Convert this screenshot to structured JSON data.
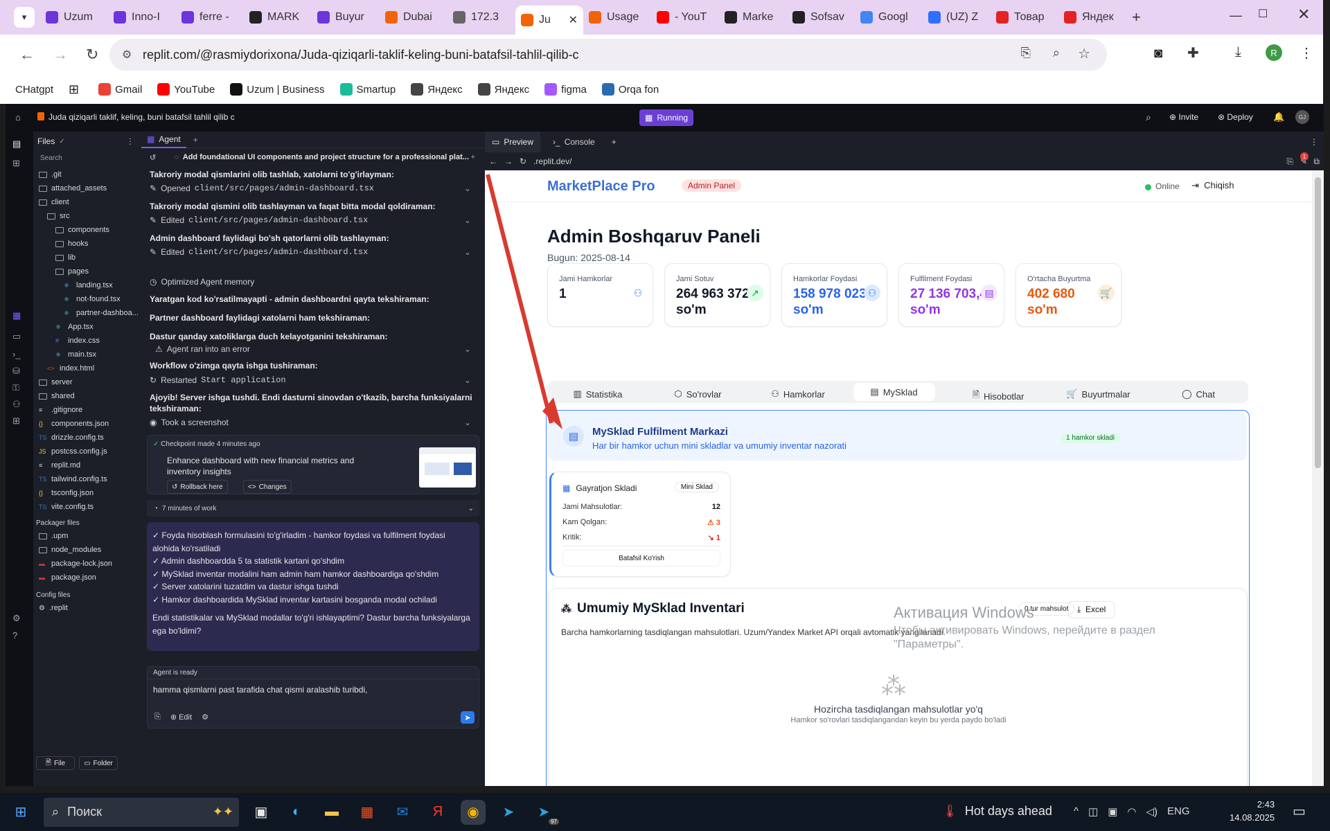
{
  "browser": {
    "tabs": [
      {
        "label": "Uzum",
        "color": "#6b35d9"
      },
      {
        "label": "Inno-I",
        "color": "#6b35d9"
      },
      {
        "label": "ferre -",
        "color": "#6b35d9"
      },
      {
        "label": "MARK",
        "color": "#222222"
      },
      {
        "label": "Buyur",
        "color": "#6b35d9"
      },
      {
        "label": "Dubai",
        "color": "#f26207"
      },
      {
        "label": "172.3",
        "color": "#666666"
      },
      {
        "label": "Ju",
        "color": "#f26207"
      },
      {
        "label": "Usage",
        "color": "#f26207"
      },
      {
        "label": "- YouT",
        "color": "#ff0000"
      },
      {
        "label": "Marke",
        "color": "#222222"
      },
      {
        "label": "Sofsav",
        "color": "#222222"
      },
      {
        "label": "Googl",
        "color": "#4285f4"
      },
      {
        "label": "(UZ) Z",
        "color": "#2f6fff"
      },
      {
        "label": "Товар",
        "color": "#e32222"
      },
      {
        "label": "Яндек",
        "color": "#e32222"
      }
    ],
    "url": "replit.com/@rasmiydorixona/Juda-qiziqarli-taklif-keling-buni-batafsil-tahlil-qilib-c",
    "bookmarks": [
      {
        "label": "CHatgpt",
        "color": "#ffffff"
      },
      {
        "label": "",
        "color": "#ffffff"
      },
      {
        "label": "Gmail",
        "color": "#ea4335"
      },
      {
        "label": "YouTube",
        "color": "#ff0000"
      },
      {
        "label": "Uzum | Business",
        "color": "#111111"
      },
      {
        "label": "Smartup",
        "color": "#1abc9c"
      },
      {
        "label": "Яндекс",
        "color": "#444444"
      },
      {
        "label": "Яндекс",
        "color": "#444444"
      },
      {
        "label": "figma",
        "color": "#a259ff"
      },
      {
        "label": "Orqa fon",
        "color": "#2b6cb0"
      }
    ],
    "profile_letter": "R"
  },
  "replit": {
    "project_title": "Juda qiziqarli taklif, keling, buni batafsil tahlil qilib c",
    "running": "Running",
    "invite": "Invite",
    "deploy": "Deploy",
    "files_title": "Files",
    "search_placeholder": "Search",
    "file_tree": [
      {
        "name": ".git",
        "indent": 0,
        "kind": "folder"
      },
      {
        "name": "attached_assets",
        "indent": 0,
        "kind": "folder"
      },
      {
        "name": "client",
        "indent": 0,
        "kind": "folder"
      },
      {
        "name": "src",
        "indent": 1,
        "kind": "folder"
      },
      {
        "name": "components",
        "indent": 2,
        "kind": "folder"
      },
      {
        "name": "hooks",
        "indent": 2,
        "kind": "folder"
      },
      {
        "name": "lib",
        "indent": 2,
        "kind": "folder"
      },
      {
        "name": "pages",
        "indent": 2,
        "kind": "folder"
      },
      {
        "name": "landing.tsx",
        "indent": 3,
        "kind": "react"
      },
      {
        "name": "not-found.tsx",
        "indent": 3,
        "kind": "react"
      },
      {
        "name": "partner-dashboa...",
        "indent": 3,
        "kind": "react"
      },
      {
        "name": "App.tsx",
        "indent": 2,
        "kind": "react"
      },
      {
        "name": "index.css",
        "indent": 2,
        "kind": "css"
      },
      {
        "name": "main.tsx",
        "indent": 2,
        "kind": "react"
      },
      {
        "name": "index.html",
        "indent": 1,
        "kind": "html"
      },
      {
        "name": "server",
        "indent": 0,
        "kind": "folder"
      },
      {
        "name": "shared",
        "indent": 0,
        "kind": "folder"
      },
      {
        "name": ".gitignore",
        "indent": 0,
        "kind": "file"
      },
      {
        "name": "components.json",
        "indent": 0,
        "kind": "json"
      },
      {
        "name": "drizzle.config.ts",
        "indent": 0,
        "kind": "ts"
      },
      {
        "name": "postcss.config.js",
        "indent": 0,
        "kind": "js"
      },
      {
        "name": "replit.md",
        "indent": 0,
        "kind": "file"
      },
      {
        "name": "tailwind.config.ts",
        "indent": 0,
        "kind": "ts"
      },
      {
        "name": "tsconfig.json",
        "indent": 0,
        "kind": "json"
      },
      {
        "name": "vite.config.ts",
        "indent": 0,
        "kind": "ts"
      }
    ],
    "packager_title": "Packager files",
    "packager_files": [
      {
        "name": ".upm",
        "kind": "folder"
      },
      {
        "name": "node_modules",
        "kind": "folder"
      },
      {
        "name": "package-lock.json",
        "kind": "npm"
      },
      {
        "name": "package.json",
        "kind": "npm"
      }
    ],
    "config_title": "Config files",
    "config_files": [
      {
        "name": ".replit"
      }
    ],
    "file_btn": "File",
    "folder_btn": "Folder",
    "agent_tab": "Agent",
    "agent_header": "Add foundational UI components and project structure for a professional plat...",
    "agent_steps": [
      {
        "title": "Takroriy modal qismlarini olib tashlab, xatolarni to'g'irlayman:",
        "action": "Opened",
        "file": "client/src/pages/admin-dashboard.tsx"
      },
      {
        "title": "Takroriy modal qismini olib tashlayman va faqat bitta modal qoldiraman:",
        "action": "Edited",
        "file": "client/src/pages/admin-dashboard.tsx"
      },
      {
        "title": "Admin dashboard faylidagi bo'sh qatorlarni olib tashlayman:",
        "action": "Edited",
        "file": "client/src/pages/admin-dashboard.tsx"
      }
    ],
    "optimized": "Optimized Agent memory",
    "line_b1": "Yaratgan kod ko'rsatilmayapti - admin dashboardni qayta tekshiraman:",
    "line_b2": "Partner dashboard faylidagi xatolarni ham tekshiraman:",
    "line_b3": "Dastur qanday xatoliklarga duch kelayotganini tekshiraman:",
    "error_line": "Agent ran into an error",
    "workflow_title": "Workflow o'zimga qayta ishga tushiraman:",
    "restarted": "Restarted",
    "restarted_target": "Start application",
    "success_title": "Ajoyib! Server ishga tushdi. Endi dasturni sinovdan o'tkazib, barcha funksiyalarni tekshiraman:",
    "screenshot": "Took a screenshot",
    "checkpoint_time": "Checkpoint made 4 minutes ago",
    "checkpoint_text": "Enhance dashboard with new financial metrics and inventory insights",
    "rollback": "Rollback here",
    "changes": "Changes",
    "work_time": "7 minutes of work",
    "summary_lines": [
      "✓ Foyda hisoblash formulasini to'g'irladim - hamkor foydasi va fulfilment foydasi alohida ko'rsatiladi",
      "✓ Admin dashboardda 5 ta statistik kartani qo'shdim",
      "✓ MySklad inventar modalini ham admin ham hamkor dashboardiga qo'shdim",
      "✓ Server xatolarini tuzatdim va dastur ishga tushdi",
      "✓ Hamkor dashboardida MySklad inventar kartasini bosganda modal ochiladi"
    ],
    "summary_question": "Endi statistikalar va MySklad modallar to'g'ri ishlayaptimi? Dastur barcha funksiyalarga ega bo'ldimi?",
    "agent_ready": "Agent is ready",
    "input_text": "hamma qismlarni past tarafida chat qismi aralashib turibdi,",
    "edit_label": "Edit",
    "preview_tab": "Preview",
    "console_tab": "Console",
    "preview_url": ".replit.dev/",
    "notif_count": "1"
  },
  "site": {
    "brand": "MarketPlace Pro",
    "badge": "Admin Panel",
    "status": "Online",
    "logout": "Chiqish",
    "page_title": "Admin Boshqaruv Paneli",
    "date": "Bugun: 2025-08-14",
    "stats": [
      {
        "label": "Jami Hamkorlar",
        "value": "1",
        "unit": "",
        "color": "#111827",
        "icon": "users-icon",
        "icon_color": "#3b82f6",
        "icon_bg": "#ffffff"
      },
      {
        "label": "Jami Sotuv",
        "value": "264 963 372",
        "unit": "so'm",
        "color": "#111827",
        "icon": "trend-up-icon",
        "icon_color": "#16a34a",
        "icon_bg": "#dcfce7"
      },
      {
        "label": "Hamkorlar Foydasi",
        "value": "158 978 023,2",
        "unit": "so'm",
        "color": "#2563eb",
        "icon": "users-icon",
        "icon_color": "#3b82f6",
        "icon_bg": "#dbeafe"
      },
      {
        "label": "Fulfilment Foydasi",
        "value": "27 136 703,48",
        "unit": "so'm",
        "color": "#9333ea",
        "icon": "warehouse-icon",
        "icon_color": "#9333ea",
        "icon_bg": "#f3e8ff"
      },
      {
        "label": "O'rtacha Buyurtma",
        "value": "402 680",
        "unit": "so'm",
        "color": "#ea580c",
        "icon": "cart-icon",
        "icon_color": "#ea580c",
        "icon_bg": "#ffedd5"
      }
    ],
    "nav": [
      "Statistika",
      "So'rovlar",
      "Hamkorlar",
      "MySklad",
      "Hisobotlar",
      "Buyurtmalar",
      "Chat"
    ],
    "active_nav": 3,
    "mysklad_title": "MySklad Fulfilment Markazi",
    "mysklad_sub": "Har bir hamkor uchun mini skladlar va umumiy inventar nazorati",
    "mysklad_badge": "1 hamkor skladi",
    "sklad_name": "Gayratjon Skladi",
    "sklad_badge": "Mini Sklad",
    "rows": [
      {
        "label": "Jami Mahsulotlar:",
        "value": "12"
      },
      {
        "label": "Kam Qolgan:",
        "value": "⚠ 3"
      },
      {
        "label": "Kritik:",
        "value": "↘ 1"
      }
    ],
    "detail_btn": "Batafsil Ko'rish",
    "inv_title": "Umumiy MySklad Inventari",
    "inv_count": "0 tur mahsulot",
    "inv_excel": "Excel",
    "inv_desc": "Barcha hamkorlarning tasdiqlangan mahsulotlari. Uzum/Yandex Market API orqali avtomatik yangilanadi.",
    "empty_title": "Hozircha tasdiqlangan mahsulotlar yo'q",
    "empty_sub": "Hamkor so'rovlari tasdiqlangandan keyin bu yerda paydo bo'ladi",
    "accent": "#3b6fd4",
    "arrow_color": "#d93a2f"
  },
  "windows": {
    "watermark_title": "Активация Windows",
    "watermark_line1": "Чтобы активировать Windows, перейдите в раздел",
    "watermark_line2": "\"Параметры\".",
    "search": "Поиск",
    "weather": "Hot days ahead",
    "lang": "ENG",
    "time": "2:43",
    "date": "14.08.2025",
    "telegram_badge": "97"
  }
}
